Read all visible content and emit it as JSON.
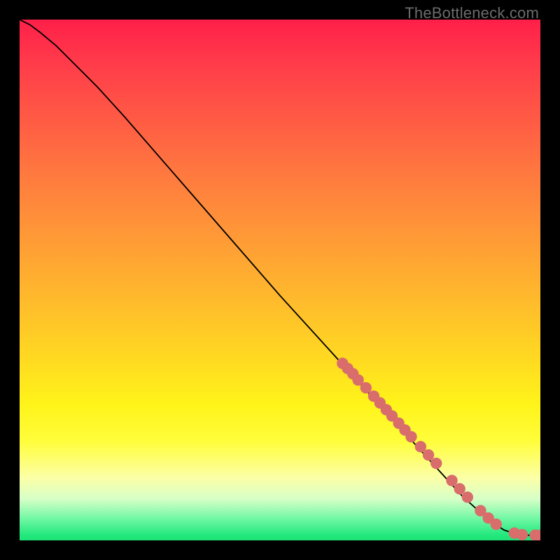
{
  "source_label": "TheBottleneck.com",
  "chart_data": {
    "type": "line",
    "title": "",
    "xlabel": "",
    "ylabel": "",
    "xlim": [
      0,
      100
    ],
    "ylim": [
      0,
      100
    ],
    "grid": false,
    "legend": false,
    "series": [
      {
        "name": "bottleneck-curve",
        "x": [
          0,
          2,
          4,
          7,
          10,
          15,
          20,
          30,
          40,
          50,
          60,
          65,
          70,
          75,
          80,
          85,
          90,
          93,
          96,
          98,
          100
        ],
        "y": [
          100,
          99,
          97.5,
          95,
          92,
          87,
          81.5,
          70,
          58.5,
          47,
          36,
          30.5,
          25,
          19.5,
          14,
          8.5,
          4,
          2,
          1,
          1,
          1
        ]
      }
    ],
    "points": {
      "name": "bottleneck-markers",
      "color": "#d86d6c",
      "radius_pct": 1.1,
      "coords": [
        [
          62,
          34
        ],
        [
          63,
          33
        ],
        [
          64,
          32
        ],
        [
          65,
          30.8
        ],
        [
          66.5,
          29.3
        ],
        [
          68,
          27.7
        ],
        [
          69.2,
          26.4
        ],
        [
          70.4,
          25.1
        ],
        [
          71.5,
          23.9
        ],
        [
          72.8,
          22.5
        ],
        [
          74,
          21.2
        ],
        [
          75.2,
          19.9
        ],
        [
          77,
          18
        ],
        [
          78.5,
          16.4
        ],
        [
          80,
          14.8
        ],
        [
          83,
          11.5
        ],
        [
          84.5,
          9.9
        ],
        [
          86,
          8.3
        ],
        [
          88.5,
          5.7
        ],
        [
          90,
          4.3
        ],
        [
          91.5,
          3.1
        ],
        [
          95,
          1.4
        ],
        [
          96.5,
          1.1
        ],
        [
          99,
          1.0
        ],
        [
          100,
          1.0
        ]
      ]
    }
  },
  "colors": {
    "curve": "#000000",
    "marker": "#d86d6c",
    "frame_bg": "#000000"
  }
}
